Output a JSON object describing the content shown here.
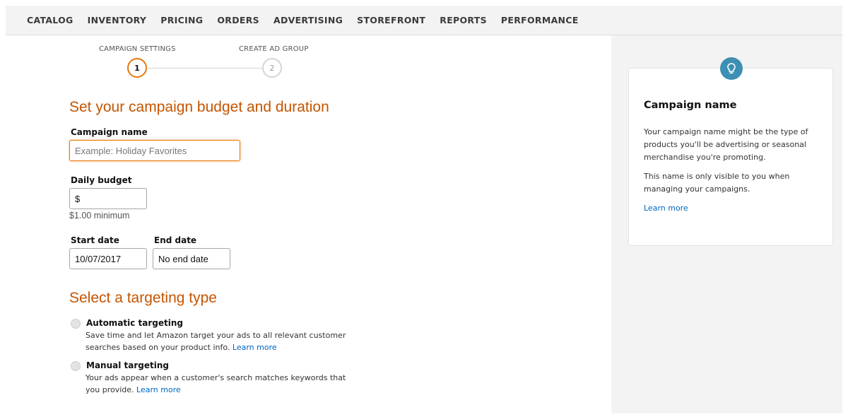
{
  "nav": {
    "items": [
      "CATALOG",
      "INVENTORY",
      "PRICING",
      "ORDERS",
      "ADVERTISING",
      "STOREFRONT",
      "REPORTS",
      "PERFORMANCE"
    ]
  },
  "stepper": {
    "steps": [
      {
        "label": "CAMPAIGN SETTINGS",
        "number": "1",
        "state": "active"
      },
      {
        "label": "CREATE AD GROUP",
        "number": "2",
        "state": "inactive"
      }
    ]
  },
  "budget_section": {
    "heading": "Set your campaign budget and duration",
    "campaign_name": {
      "label": "Campaign name",
      "value": "",
      "placeholder": "Example: Holiday Favorites"
    },
    "daily_budget": {
      "label": "Daily budget",
      "value": "$",
      "hint": "$1.00 minimum"
    },
    "start_date": {
      "label": "Start date",
      "value": "10/07/2017"
    },
    "end_date": {
      "label": "End date",
      "value": "No end date"
    }
  },
  "targeting_section": {
    "heading": "Select a targeting type",
    "options": [
      {
        "title": "Automatic targeting",
        "description": "Save time and let Amazon target your ads to all relevant customer searches based on your product info.",
        "link": "Learn more"
      },
      {
        "title": "Manual targeting",
        "description": "Your ads appear when a customer's search matches keywords that you provide.",
        "link": "Learn more"
      }
    ]
  },
  "help_card": {
    "icon": "lightbulb-icon",
    "title": "Campaign name",
    "paragraph1": "Your campaign name might be the type of products you'll be advertising or seasonal merchandise you're promoting.",
    "paragraph2": "This name is only visible to you when managing your campaigns.",
    "link": "Learn more"
  },
  "colors": {
    "accent_orange": "#c45500",
    "focus_orange": "#e77600",
    "link_blue": "#0066c0",
    "bulb_blue": "#3d8fb4"
  }
}
